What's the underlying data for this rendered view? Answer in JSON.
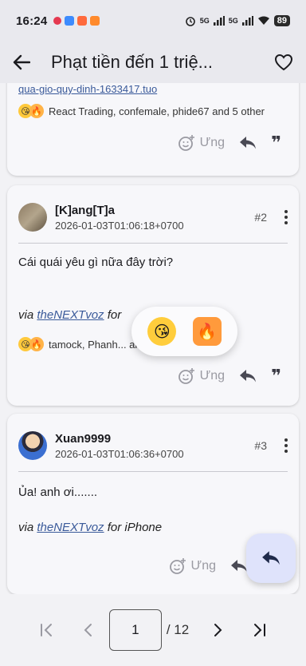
{
  "status": {
    "time": "16:24",
    "battery": "89",
    "net1": "5G",
    "net2": "5G"
  },
  "appbar": {
    "title": "Phạt tiền đến 1 triệ..."
  },
  "post1": {
    "link_fragment": "qua-gio-quy-dinh-1633417.tuo",
    "reactors": "React Trading, confemale, phide67 and 5 other",
    "like_label": "Ưng"
  },
  "post2": {
    "username": "[K]ang[T]a",
    "timestamp": "2026-01-03T01:06:18+0700",
    "number": "#2",
    "body": "Cái quái yêu gì nữa đây trời?",
    "via_prefix": "via",
    "via_app": "theNEXTvoz",
    "via_suffix": "for",
    "reactors": "tamock, Phanh... ai and 60 o",
    "like_label": "Ưng"
  },
  "post3": {
    "username": "Xuan9999",
    "timestamp": "2026-01-03T01:06:36+0700",
    "number": "#3",
    "body": "Ủa! anh ơi.......",
    "via_prefix": "via",
    "via_app": "theNEXTvoz",
    "via_suffix": "for iPhone",
    "like_label": "Ưng"
  },
  "pager": {
    "current_page": "1",
    "total_label": "/ 12"
  },
  "colors": {
    "accent": "#3a5a9a",
    "fab_bg": "#dfe3fb",
    "bar_bg": "#e9e9ee"
  }
}
